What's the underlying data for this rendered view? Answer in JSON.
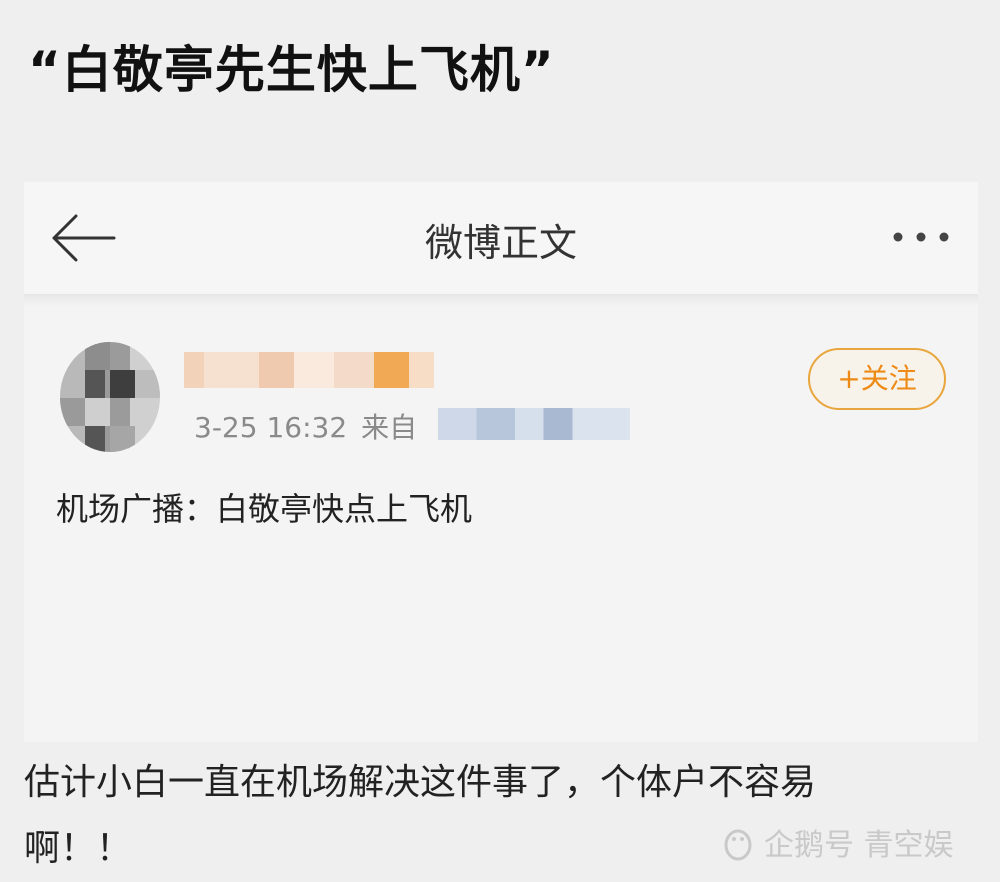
{
  "headline": "“白敬亭先生快上飞机”",
  "screenshot": {
    "topbar": {
      "title": "微博正文",
      "back_icon": "arrow-left-icon",
      "more_icon": "more-dots-icon"
    },
    "post": {
      "timestamp": "3-25 16:32",
      "source_prefix": "来自",
      "follow_label": "+关注",
      "text": "机场广播：白敬亭快点上飞机"
    }
  },
  "caption": {
    "line1": "估计小白一直在机场解决这件事了，个体户不容易",
    "line2": "啊！！"
  },
  "watermark": {
    "text": "企鹅号 青空娱",
    "icon": "penguin-icon"
  },
  "colors": {
    "follow_accent": "#ee8a16",
    "meta_gray": "#8a8a8a"
  }
}
